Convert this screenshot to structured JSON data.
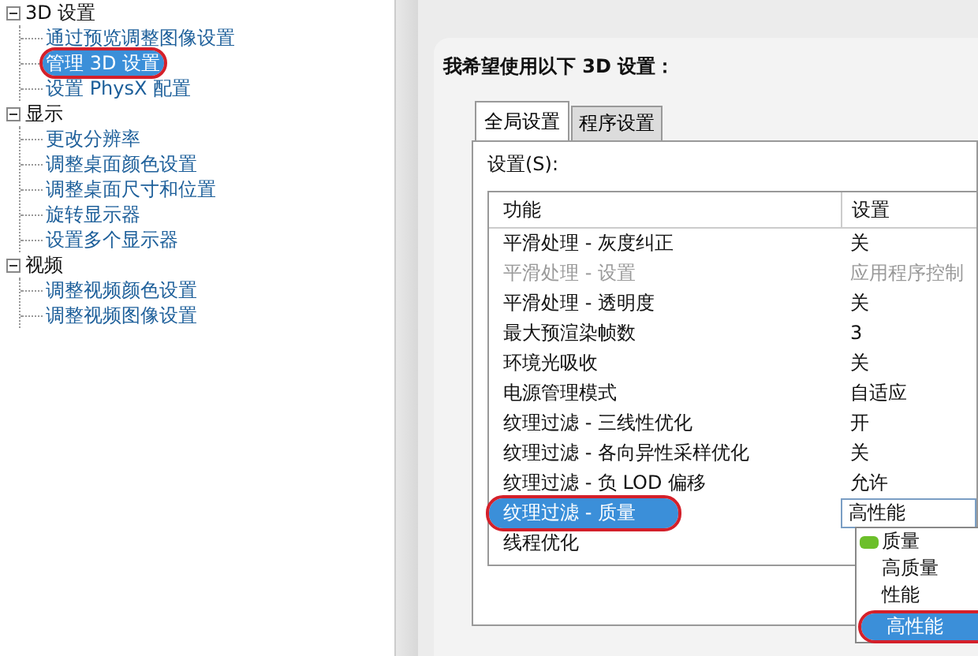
{
  "tree": [
    {
      "label": "3D 设置",
      "expanded": true,
      "children": [
        {
          "label": "通过预览调整图像设置",
          "selected": false
        },
        {
          "label": "管理 3D 设置",
          "selected": true,
          "circled": true
        },
        {
          "label": "设置 PhysX 配置",
          "selected": false
        }
      ]
    },
    {
      "label": "显示",
      "expanded": true,
      "children": [
        {
          "label": "更改分辨率",
          "selected": false
        },
        {
          "label": "调整桌面颜色设置",
          "selected": false
        },
        {
          "label": "调整桌面尺寸和位置",
          "selected": false
        },
        {
          "label": "旋转显示器",
          "selected": false
        },
        {
          "label": "设置多个显示器",
          "selected": false
        }
      ]
    },
    {
      "label": "视频",
      "expanded": true,
      "children": [
        {
          "label": "调整视频颜色设置",
          "selected": false
        },
        {
          "label": "调整视频图像设置",
          "selected": false
        }
      ]
    }
  ],
  "heading": "我希望使用以下 3D 设置：",
  "tabs": [
    {
      "label": "全局设置",
      "selected": true
    },
    {
      "label": "程序设置",
      "selected": false
    }
  ],
  "settings_label": "设置(S):",
  "table": {
    "columns": [
      "功能",
      "设置"
    ],
    "rows": [
      {
        "feature": "平滑处理 - 灰度纠正",
        "value": "关",
        "disabled": false,
        "selected": false
      },
      {
        "feature": "平滑处理 - 设置",
        "value": "应用程序控制",
        "disabled": true,
        "selected": false
      },
      {
        "feature": "平滑处理 - 透明度",
        "value": "关",
        "disabled": false,
        "selected": false
      },
      {
        "feature": "最大预渲染帧数",
        "value": "3",
        "disabled": false,
        "selected": false
      },
      {
        "feature": "环境光吸收",
        "value": "关",
        "disabled": false,
        "selected": false
      },
      {
        "feature": "电源管理模式",
        "value": "自适应",
        "disabled": false,
        "selected": false
      },
      {
        "feature": "纹理过滤 - 三线性优化",
        "value": "开",
        "disabled": false,
        "selected": false
      },
      {
        "feature": "纹理过滤 - 各向异性采样优化",
        "value": "关",
        "disabled": false,
        "selected": false
      },
      {
        "feature": "纹理过滤 - 负 LOD 偏移",
        "value": "允许",
        "disabled": false,
        "selected": false
      },
      {
        "feature": "纹理过滤 - 质量",
        "value": "高性能",
        "disabled": false,
        "selected": true,
        "circled": true
      },
      {
        "feature": "线程优化",
        "disabled": false,
        "selected": false
      }
    ]
  },
  "dropdown": {
    "options": [
      {
        "label": "质量",
        "recommended": true,
        "selected": false
      },
      {
        "label": "高质量",
        "recommended": false,
        "selected": false
      },
      {
        "label": "性能",
        "recommended": false,
        "selected": false
      },
      {
        "label": "高性能",
        "recommended": false,
        "selected": true,
        "circled": true
      }
    ]
  }
}
